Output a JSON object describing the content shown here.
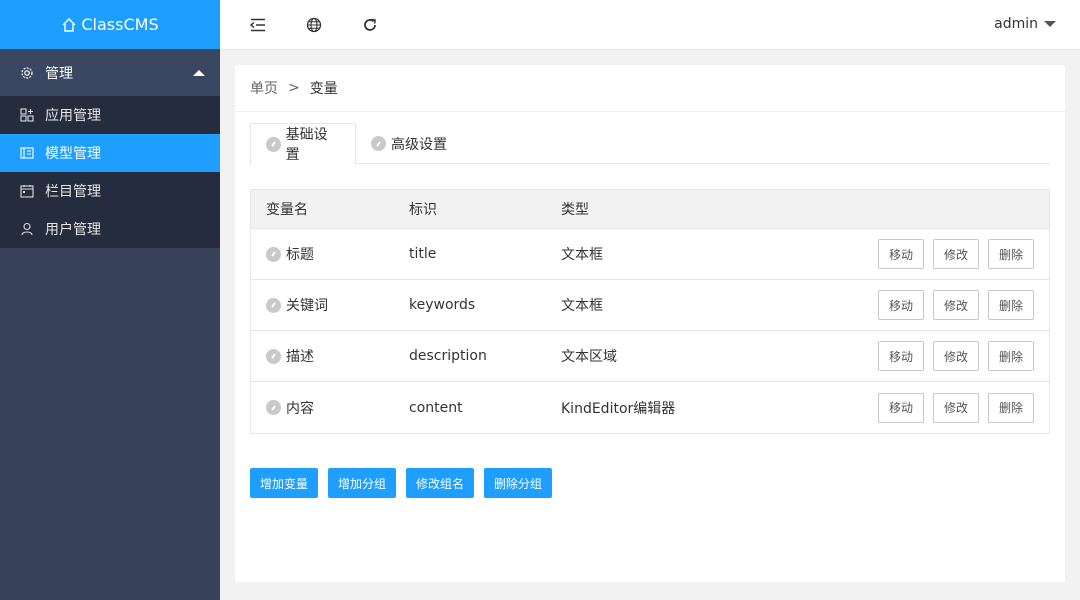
{
  "app": {
    "title": "ClassCMS"
  },
  "sidebar": {
    "group": {
      "label": "管理"
    },
    "items": [
      {
        "label": "应用管理",
        "icon": "apps-icon",
        "active": false
      },
      {
        "label": "模型管理",
        "icon": "model-icon",
        "active": true
      },
      {
        "label": "栏目管理",
        "icon": "calendar-icon",
        "active": false
      },
      {
        "label": "用户管理",
        "icon": "user-icon",
        "active": false
      }
    ]
  },
  "header": {
    "icons": [
      "menu-collapse-icon",
      "globe-icon",
      "refresh-icon"
    ],
    "user": "admin"
  },
  "breadcrumb": {
    "home": "单页",
    "separator": ">",
    "current": "变量"
  },
  "tabs": [
    {
      "label": "基础设置",
      "active": true
    },
    {
      "label": "高级设置",
      "active": false
    }
  ],
  "table": {
    "headers": [
      "变量名",
      "标识",
      "类型"
    ],
    "rows": [
      {
        "name": "标题",
        "id": "title",
        "type": "文本框"
      },
      {
        "name": "关键词",
        "id": "keywords",
        "type": "文本框"
      },
      {
        "name": "描述",
        "id": "description",
        "type": "文本区域"
      },
      {
        "name": "内容",
        "id": "content",
        "type": "KindEditor编辑器"
      }
    ],
    "row_actions": {
      "move": "移动",
      "edit": "修改",
      "delete": "删除"
    }
  },
  "actions": {
    "add_variable": "增加变量",
    "add_group": "增加分组",
    "rename_group": "修改组名",
    "delete_group": "删除分组"
  },
  "colors": {
    "accent": "#1e9fff",
    "sidebar": "#374159",
    "submenu": "#252c3d"
  }
}
